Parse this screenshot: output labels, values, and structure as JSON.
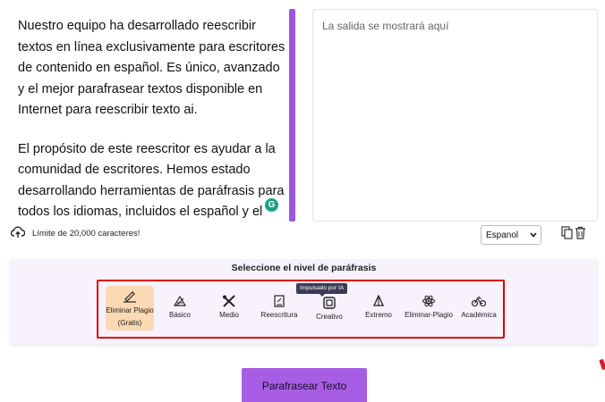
{
  "input": {
    "paragraphs": [
      "Nuestro equipo ha desarrollado reescribir textos en línea exclusivamente para escritores de contenido en español. Es único, avanzado y el mejor parafrasear textos disponible en Internet para reescribir texto ai.",
      "El propósito de este reescritor es ayudar a la comunidad de escritores. Hemos estado desarrollando herramientas de paráfrasis para todos los idiomas, incluidos el español y el portugués."
    ],
    "grammarly_glyph": "G"
  },
  "output": {
    "placeholder": "La salida se mostrará aquí"
  },
  "toolbar": {
    "char_limit": "Límite de 20,000 caracteres!",
    "language_selected": "Espanol"
  },
  "level_section": {
    "title": "Seleccione el nivel de paráfrasis",
    "ai_badge": "Impulsado por IA",
    "modes": [
      {
        "label": "Eliminar Plagio",
        "sublabel": "(Gratis)",
        "icon": "pen-icon",
        "active": true
      },
      {
        "label": "Básico",
        "icon": "basic-icon",
        "active": false
      },
      {
        "label": "Medio",
        "icon": "tools-icon",
        "active": false
      },
      {
        "label": "Reescritura",
        "icon": "rewrite-icon",
        "active": false
      },
      {
        "label": "Creativo",
        "icon": "creative-icon",
        "active": false
      },
      {
        "label": "Extremo",
        "icon": "flame-icon",
        "active": false
      },
      {
        "label": "Eliminar-Plagio",
        "icon": "atom-icon",
        "active": false
      },
      {
        "label": "Académica",
        "icon": "bicycle-icon",
        "active": false
      }
    ]
  },
  "actions": {
    "paraphrase_label": "Parafrasear Texto"
  },
  "colors": {
    "accent_purple": "#a75ee5",
    "scrollbar_purple": "#9b57e0",
    "active_mode_bg": "#fbd9b4",
    "highlight_red": "#e00000",
    "grammarly_green": "#15a380"
  }
}
